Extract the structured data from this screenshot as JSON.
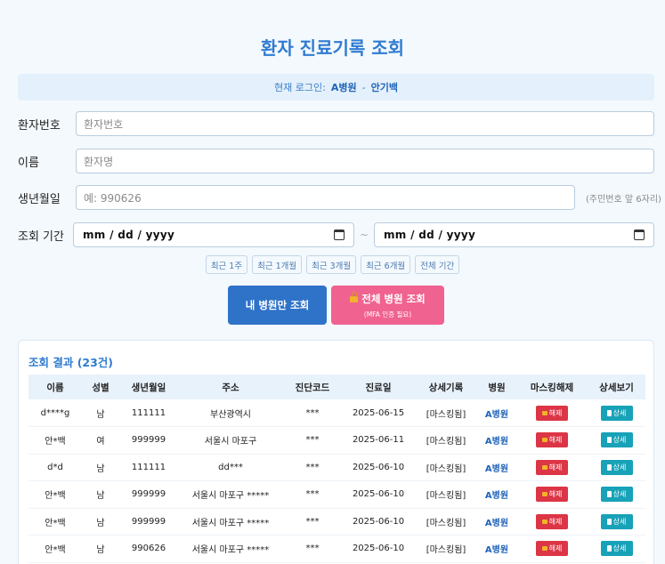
{
  "page": {
    "title": "환자 진료기록 조회"
  },
  "login": {
    "prefix": "현재 로그인:",
    "hospital": "A병원",
    "separator": "-",
    "user": "안기백"
  },
  "form": {
    "patient_no": {
      "label": "환자번호",
      "placeholder": "환자번호"
    },
    "name": {
      "label": "이름",
      "placeholder": "환자명"
    },
    "birth": {
      "label": "생년월일",
      "placeholder": "예: 990626",
      "hint": "(주민번호 앞 6자리)"
    },
    "period": {
      "label": "조회 기간",
      "start": "mm / dd / yyyy",
      "tilde": "~",
      "end": "mm / dd / yyyy"
    }
  },
  "range_buttons": [
    "최근 1주",
    "최근 1개월",
    "최근 3개월",
    "최근 6개월",
    "전체 기간"
  ],
  "actions": {
    "own": "내 병원만 조회",
    "all": "전체 병원 조회",
    "all_sub": "(MFA 인증 필요)"
  },
  "results": {
    "title": "조회 결과 (23건)",
    "columns": [
      "이름",
      "성별",
      "생년월일",
      "주소",
      "진단코드",
      "진료일",
      "상세기록",
      "병원",
      "마스킹해제",
      "상세보기"
    ],
    "unmask_label": "해제",
    "detail_label": "상세",
    "rows": [
      {
        "name": "d****g",
        "sex": "남",
        "birth": "111111",
        "address": "부산광역시",
        "code": "***",
        "date": "2025-06-15",
        "record": "[마스킹됨]",
        "hospital": "A병원"
      },
      {
        "name": "안*백",
        "sex": "여",
        "birth": "999999",
        "address": "서울시 마포구",
        "code": "***",
        "date": "2025-06-11",
        "record": "[마스킹됨]",
        "hospital": "A병원"
      },
      {
        "name": "d*d",
        "sex": "남",
        "birth": "111111",
        "address": "dd***",
        "code": "***",
        "date": "2025-06-10",
        "record": "[마스킹됨]",
        "hospital": "A병원"
      },
      {
        "name": "안*백",
        "sex": "남",
        "birth": "999999",
        "address": "서울시 마포구 *****",
        "code": "***",
        "date": "2025-06-10",
        "record": "[마스킹됨]",
        "hospital": "A병원"
      },
      {
        "name": "안*백",
        "sex": "남",
        "birth": "999999",
        "address": "서울시 마포구 *****",
        "code": "***",
        "date": "2025-06-10",
        "record": "[마스킹됨]",
        "hospital": "A병원"
      },
      {
        "name": "안*백",
        "sex": "남",
        "birth": "990626",
        "address": "서울시 마포구 *****",
        "code": "***",
        "date": "2025-06-10",
        "record": "[마스킹됨]",
        "hospital": "A병원"
      }
    ]
  }
}
